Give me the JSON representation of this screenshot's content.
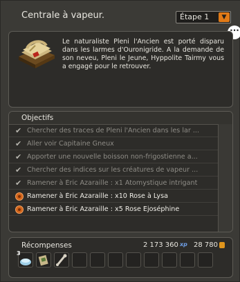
{
  "header": {
    "title": "Centrale à vapeur.",
    "step_label": "Étape 1",
    "chat_icon": "ellipsis-bubble-icon"
  },
  "description": {
    "text": "Le naturaliste Pleni l'Ancien est porté disparu dans les larmes d'Ouronigride. A la demande de son neveu, Pleni le Jeune, Hyppolite Tairmy vous a engagé pour le retrouver.",
    "icon": "quest-scroll-icon"
  },
  "objectives": {
    "title": "Objectifs",
    "items": [
      {
        "label": "Chercher des traces de Pleni l'Ancien dans les lar ...",
        "done": true
      },
      {
        "label": "Aller voir Capitaine Gneux",
        "done": true
      },
      {
        "label": "Apporter une nouvelle boisson non-frigostienne a...",
        "done": true
      },
      {
        "label": "Chercher des indices sur les créatures de vapeur ...",
        "done": true
      },
      {
        "label": "Ramener à Éric Azaraille : x1 Atomystique intrigant",
        "done": true
      },
      {
        "label": "Ramener à Éric Azaraille : x10 Rose à Lysa",
        "done": false
      },
      {
        "label": "Ramener à Éric Azaraille : x5 Rose Ejoséphine",
        "done": false
      }
    ]
  },
  "rewards": {
    "title": "Récompenses",
    "xp": "2 173 360",
    "xp_unit": "xp",
    "kamas": "28 780",
    "slots": [
      {
        "icon": "potion-item-icon",
        "badge": "3"
      },
      {
        "icon": "parchment-item-icon",
        "badge": ""
      },
      {
        "icon": "bone-item-icon",
        "badge": ""
      },
      {
        "icon": "",
        "badge": ""
      },
      {
        "icon": "",
        "badge": ""
      },
      {
        "icon": "",
        "badge": ""
      },
      {
        "icon": "",
        "badge": ""
      },
      {
        "icon": "",
        "badge": ""
      },
      {
        "icon": "",
        "badge": ""
      },
      {
        "icon": "",
        "badge": ""
      },
      {
        "icon": "",
        "badge": ""
      }
    ]
  },
  "colors": {
    "accent": "#e07a17",
    "panel_bg": "#3b3a36",
    "box_bg": "#2d2c29",
    "done_text": "#8e8c86",
    "active_text": "#f0eee8"
  }
}
